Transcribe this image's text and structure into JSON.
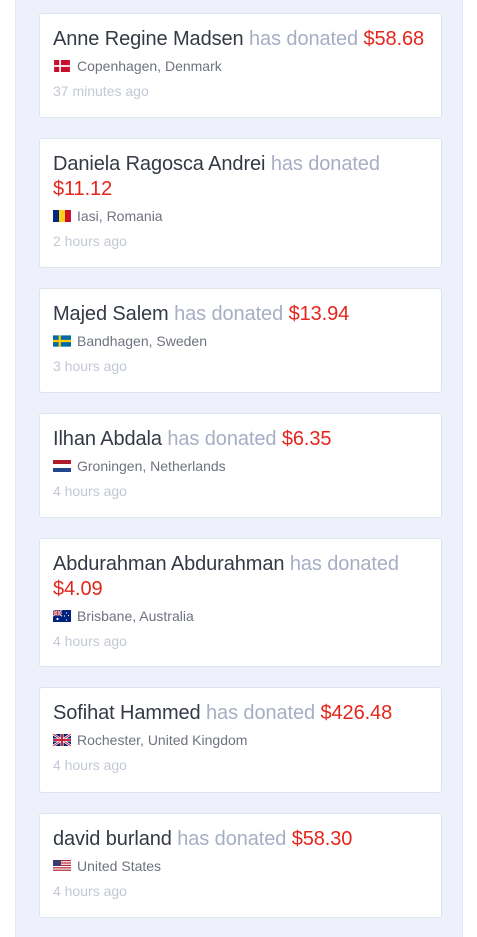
{
  "verb": "has donated",
  "donations": [
    {
      "name": "Anne Regine Madsen",
      "amount": "$58.68",
      "location": "Copenhagen, Denmark",
      "flag": "denmark-flag-icon",
      "time": "37 minutes ago"
    },
    {
      "name": "Daniela Ragosca Andrei",
      "amount": "$11.12",
      "location": "Iasi, Romania",
      "flag": "romania-flag-icon",
      "time": "2 hours ago"
    },
    {
      "name": "Majed Salem",
      "amount": "$13.94",
      "location": "Bandhagen, Sweden",
      "flag": "sweden-flag-icon",
      "time": "3 hours ago"
    },
    {
      "name": "Ilhan Abdala",
      "amount": "$6.35",
      "location": "Groningen, Netherlands",
      "flag": "netherlands-flag-icon",
      "time": "4 hours ago"
    },
    {
      "name": "Abdurahman Abdurahman",
      "amount": "$4.09",
      "location": "Brisbane, Australia",
      "flag": "australia-flag-icon",
      "time": "4 hours ago"
    },
    {
      "name": "Sofihat Hammed",
      "amount": "$426.48",
      "location": "Rochester, United Kingdom",
      "flag": "uk-flag-icon",
      "time": "4 hours ago"
    },
    {
      "name": "david burland",
      "amount": "$58.30",
      "location": "United States",
      "flag": "usa-flag-icon",
      "time": "4 hours ago"
    }
  ],
  "colors": {
    "panel_bg": "#eef1fb",
    "name": "#333a45",
    "verb": "#a7aec4",
    "amount": "#e3261c",
    "location": "#6f7380",
    "time": "#c3c8d5"
  }
}
